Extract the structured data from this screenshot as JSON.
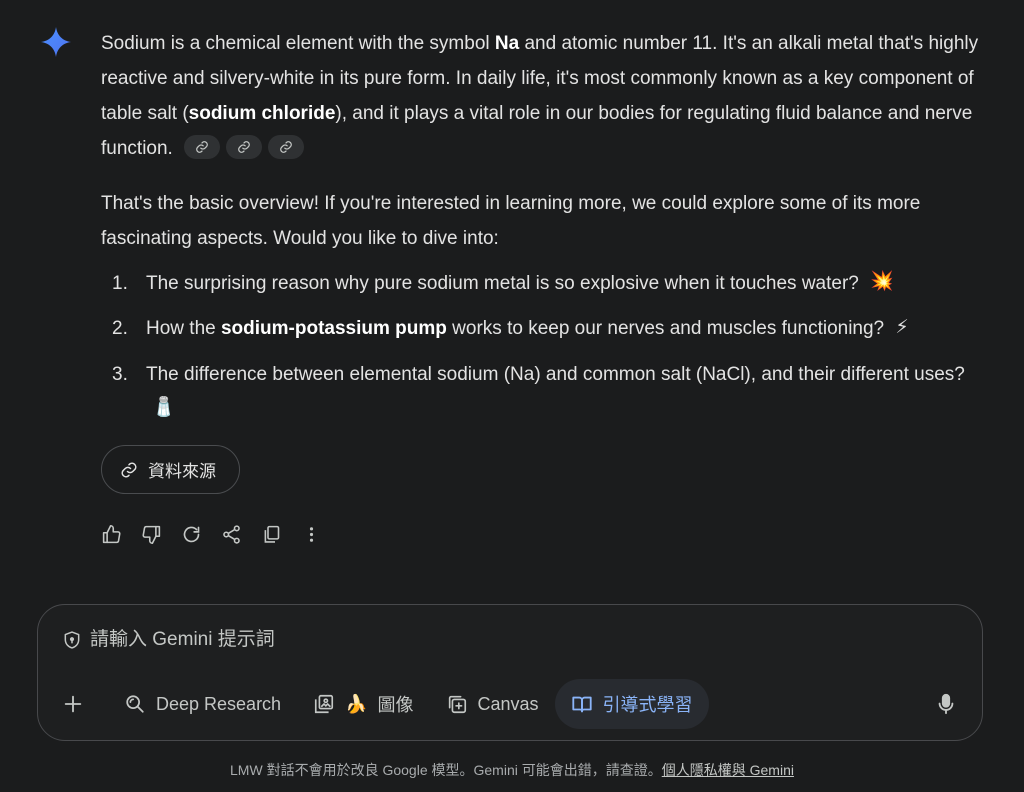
{
  "response": {
    "p1_a": "Sodium is a chemical element with the symbol ",
    "p1_b": "Na",
    "p1_c": " and atomic number 11. It's an alkali metal that's highly reactive and silvery-white in its pure form. In daily life, it's most commonly known as a key component of table salt (",
    "p1_d": "sodium chloride",
    "p1_e": "), and it plays a vital role in our bodies for regulating fluid balance and nerve function.",
    "p2": "That's the basic overview! If you're interested in learning more, we could explore some of its more fascinating aspects. Would you like to dive into:",
    "items": [
      {
        "num": "1.",
        "a": "The surprising reason why pure sodium metal is so explosive when it touches water? ",
        "emoji": "💥"
      },
      {
        "num": "2.",
        "a": "How the ",
        "b": "sodium-potassium pump",
        "c": " works to keep our nerves and muscles functioning? ",
        "emoji": "⚡"
      },
      {
        "num": "3.",
        "a": "The difference between elemental sodium (Na) and common salt (NaCl), and their different uses? ",
        "emoji": "🧂"
      }
    ]
  },
  "sources_label": "資料來源",
  "composer": {
    "placeholder": "請輸入 Gemini 提示詞",
    "tools": {
      "deep_research": "Deep Research",
      "image_emoji": "🍌",
      "image": "圖像",
      "canvas": "Canvas",
      "guided_learning": "引導式學習"
    }
  },
  "footer": {
    "text": "LMW 對話不會用於改良 Google 模型。Gemini 可能會出錯，請查證。",
    "link": "個人隱私權與 Gemini"
  },
  "colors": {
    "accent": "#8ab4f8",
    "background": "#1b1c1d",
    "text": "#e3e3e3"
  }
}
